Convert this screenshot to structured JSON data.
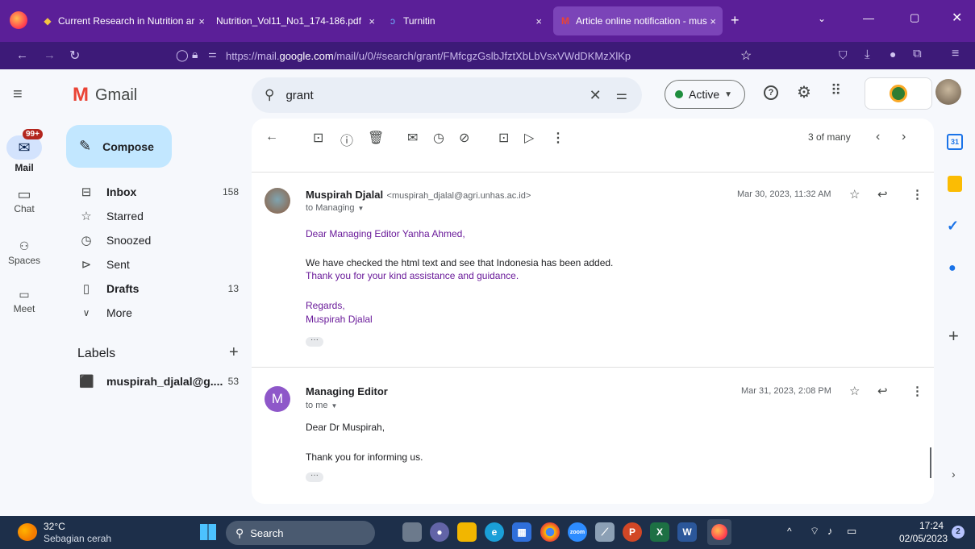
{
  "browser": {
    "tabs": [
      {
        "label": "Current Research in Nutrition ar",
        "close": "×"
      },
      {
        "label": "Nutrition_Vol11_No1_174-186.pdf",
        "close": "×"
      },
      {
        "label": "Turnitin",
        "close": "×"
      },
      {
        "label": "Article online notification - mus",
        "close": "×"
      }
    ],
    "new_tab": "+",
    "url_prefix": "https://mail.",
    "url_domain": "google.com",
    "url_path": "/mail/u/0/#search/grant/FMfcgzGslbJfztXbLbVsxVWdDKMzXlKp"
  },
  "gmail": {
    "logo_text": "Gmail",
    "compose_label": "Compose",
    "search_query": "grant",
    "status_label": "Active",
    "rail": [
      {
        "label": "Mail",
        "badge": "99+"
      },
      {
        "label": "Chat"
      },
      {
        "label": "Spaces"
      },
      {
        "label": "Meet"
      }
    ],
    "nav": [
      {
        "label": "Inbox",
        "count": "158",
        "bold": true
      },
      {
        "label": "Starred",
        "count": ""
      },
      {
        "label": "Snoozed",
        "count": ""
      },
      {
        "label": "Sent",
        "count": ""
      },
      {
        "label": "Drafts",
        "count": "13",
        "bold": true
      },
      {
        "label": "More",
        "count": ""
      }
    ],
    "labels_heading": "Labels",
    "labels": [
      {
        "label": "muspirah_djalal@g....",
        "count": "53"
      }
    ],
    "pagination": "3 of many",
    "messages": [
      {
        "sender": "Muspirah Djalal",
        "address": "<muspirah_djalal@agri.unhas.ac.id>",
        "to": "to Managing",
        "date": "Mar 30, 2023, 11:32 AM",
        "lines": [
          "Dear Managing Editor Yanha Ahmed,",
          "We have checked the html text and see that Indonesia has been added.",
          "Thank you for your kind assistance and guidance.",
          "Regards,",
          "Muspirah Djalal"
        ]
      },
      {
        "sender": "Managing Editor",
        "avatar_letter": "M",
        "to": "to me",
        "date": "Mar 31, 2023, 2:08 PM",
        "lines": [
          "Dear Dr Muspirah,",
          "Thank you for informing us."
        ]
      }
    ],
    "colors": {
      "accent": "#5b1f98",
      "compose_bg": "#c2e7ff",
      "avatar_purple": "#8e57c9",
      "active_green": "#1e8e3e"
    }
  },
  "taskbar": {
    "temperature": "32°C",
    "weather": "Sebagian cerah",
    "search_label": "Search",
    "time": "17:24",
    "date": "02/05/2023",
    "notifications": "2"
  }
}
